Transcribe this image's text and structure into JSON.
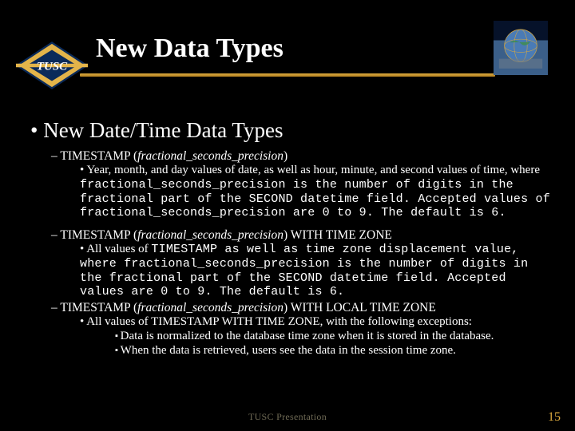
{
  "header": {
    "title": "New Data Types",
    "logo_text": "TUSC"
  },
  "h2": "New Date/Time Data Types",
  "sections": [
    {
      "heading_prefix": "TIMESTAMP (",
      "heading_param": "fractional_seconds_precision",
      "heading_suffix": ")",
      "body_segments": [
        {
          "t": "Year, month, and day values of date, as well as hour, minute, and second values of time, where ",
          "cls": ""
        },
        {
          "t": "fractional_seconds_precision is the number of digits in the fractional part of the SECOND datetime field. Accepted values of fractional_seconds_precision are 0 to 9. The default is 6.",
          "cls": "mono"
        }
      ]
    },
    {
      "heading_prefix": "TIMESTAMP (",
      "heading_param": "fractional_seconds_precision",
      "heading_suffix": ") WITH TIME ZONE",
      "body_segments": [
        {
          "t": "All values of ",
          "cls": ""
        },
        {
          "t": "TIMESTAMP as well as time zone displacement value, where fractional_seconds_precision is the number of digits in the fractional part of the SECOND datetime field. Accepted values are 0 to 9. The default is 6.",
          "cls": "mono"
        }
      ]
    },
    {
      "heading_prefix": "TIMESTAMP (",
      "heading_param": "fractional_seconds_precision",
      "heading_suffix": ") WITH LOCAL TIME ZONE",
      "intro": "All values of TIMESTAMP WITH TIME ZONE, with the following exceptions:",
      "subitems": [
        "Data is normalized to the database time zone when it is stored in the database.",
        "When the data is retrieved, users see the data in the session time zone."
      ]
    }
  ],
  "footer": "TUSC Presentation",
  "page_number": "15",
  "chart_data": null
}
